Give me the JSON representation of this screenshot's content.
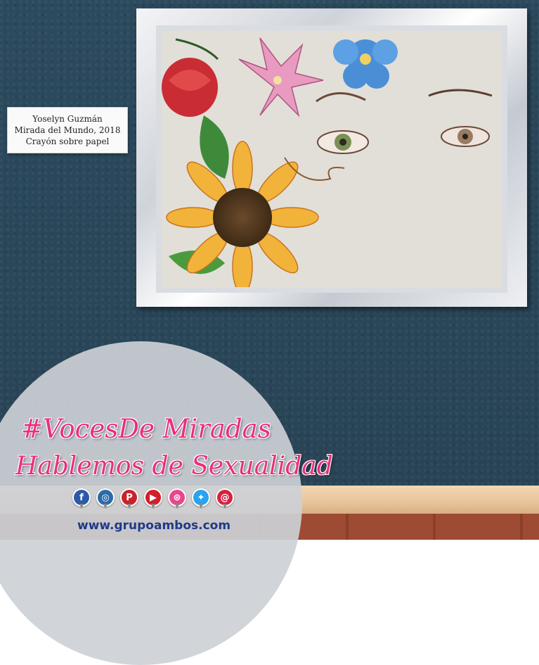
{
  "placard": {
    "artist": "Yoselyn Guzmán",
    "title": "Mirada del Mundo, 2018",
    "medium": "Crayón sobre papel"
  },
  "campaign": {
    "hashtag": "#VocesDe Miradas",
    "subtitle": "Hablemos de Sexualidad",
    "website": "www.grupoambos.com"
  },
  "social_icons": [
    {
      "name": "facebook-icon",
      "glyph": "f",
      "color": "#2d5aa8"
    },
    {
      "name": "instagram-icon",
      "glyph": "◎",
      "color": "#2d6aa8"
    },
    {
      "name": "pinterest-icon",
      "glyph": "P",
      "color": "#c8232c"
    },
    {
      "name": "youtube-icon",
      "glyph": "▶",
      "color": "#d21f2b"
    },
    {
      "name": "dribbble-icon",
      "glyph": "⊛",
      "color": "#e7488c"
    },
    {
      "name": "twitter-icon",
      "glyph": "✦",
      "color": "#2aa3ef"
    },
    {
      "name": "email-icon",
      "glyph": "@",
      "color": "#d8203f"
    }
  ],
  "colors": {
    "wall": "#2c4a5e",
    "accent_pink": "#e8307e",
    "link_blue": "#1f3a8a"
  }
}
